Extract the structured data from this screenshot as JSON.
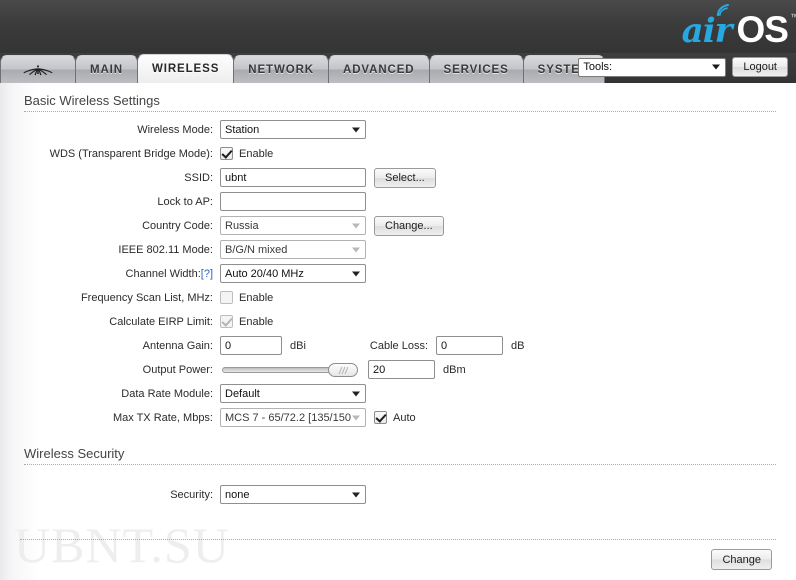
{
  "header": {
    "logo_air": "air",
    "logo_os": "OS",
    "logo_tm": "™",
    "wifi_icon": "wifi-signal-icon"
  },
  "tabs": [
    {
      "label": "",
      "name": "tab-home-logo",
      "active": false
    },
    {
      "label": "MAIN",
      "name": "tab-main",
      "active": false
    },
    {
      "label": "WIRELESS",
      "name": "tab-wireless",
      "active": true
    },
    {
      "label": "NETWORK",
      "name": "tab-network",
      "active": false
    },
    {
      "label": "ADVANCED",
      "name": "tab-advanced",
      "active": false
    },
    {
      "label": "SERVICES",
      "name": "tab-services",
      "active": false
    },
    {
      "label": "SYSTEM",
      "name": "tab-system",
      "active": false
    }
  ],
  "toolbar": {
    "tools_value": "Tools:",
    "logout_label": "Logout"
  },
  "sections": {
    "basic": {
      "title": "Basic Wireless Settings",
      "fields": {
        "wireless_mode": {
          "label": "Wireless Mode:",
          "value": "Station"
        },
        "wds": {
          "label": "WDS (Transparent Bridge Mode):",
          "checkbox_label": "Enable",
          "checked": true
        },
        "ssid": {
          "label": "SSID:",
          "value": "ubnt",
          "button": "Select..."
        },
        "lock_to_ap": {
          "label": "Lock to AP:",
          "value": ""
        },
        "country_code": {
          "label": "Country Code:",
          "value": "Russia",
          "button": "Change..."
        },
        "ieee_mode": {
          "label": "IEEE 802.11 Mode:",
          "value": "B/G/N mixed"
        },
        "channel_width": {
          "label": "Channel Width:",
          "help": "[?]",
          "value": "Auto 20/40 MHz"
        },
        "freq_scan_list": {
          "label": "Frequency Scan List, MHz:",
          "checkbox_label": "Enable",
          "checked": false
        },
        "calc_eirp": {
          "label": "Calculate EIRP Limit:",
          "checkbox_label": "Enable",
          "checked": true
        },
        "antenna_gain": {
          "label": "Antenna Gain:",
          "value": "0",
          "unit": "dBi"
        },
        "cable_loss": {
          "label": "Cable Loss:",
          "value": "0",
          "unit": "dB"
        },
        "output_power": {
          "label": "Output Power:",
          "value": "20",
          "unit": "dBm"
        },
        "data_rate_module": {
          "label": "Data Rate Module:",
          "value": "Default"
        },
        "max_tx_rate": {
          "label": "Max TX Rate, Mbps:",
          "value": "MCS 7 - 65/72.2 [135/150",
          "auto_label": "Auto",
          "auto_checked": true
        }
      }
    },
    "security": {
      "title": "Wireless Security",
      "fields": {
        "security": {
          "label": "Security:",
          "value": "none"
        }
      }
    }
  },
  "footer": {
    "change_label": "Change"
  },
  "watermark": "UBNT.SU",
  "colors": {
    "accent_blue": "#27a8e0",
    "link_blue": "#2b64c6",
    "header_dark": "#3b3b3b"
  }
}
